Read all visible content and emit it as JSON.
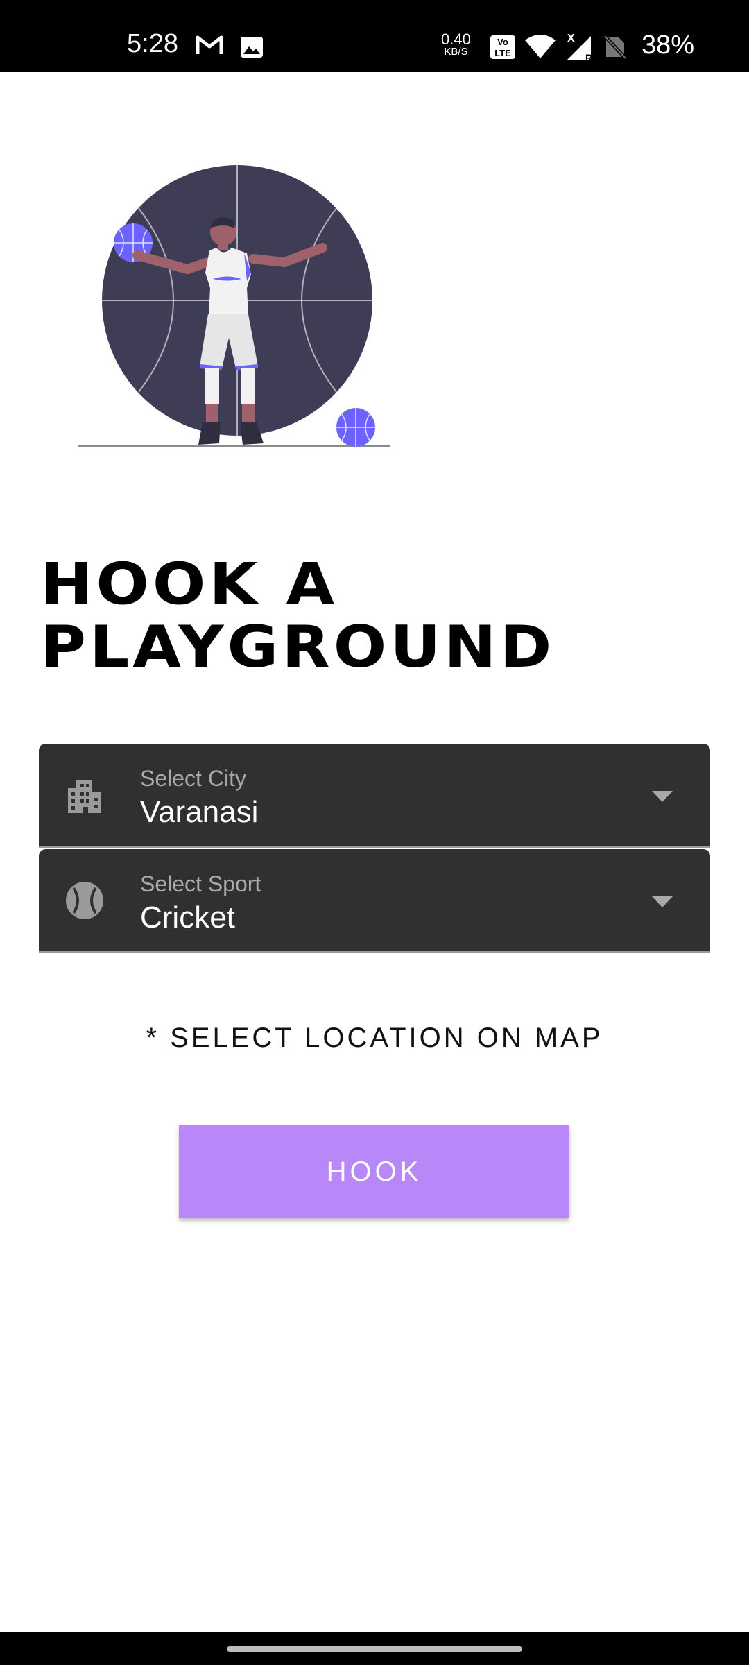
{
  "status_bar": {
    "time": "5:28",
    "net_speed": "0.40",
    "net_speed_unit": "KB/S",
    "battery": "38%",
    "icons": [
      "gmail-icon",
      "gallery-icon",
      "volte-icon",
      "wifi-icon",
      "signal-icon",
      "no-sim-icon"
    ]
  },
  "page": {
    "title_line1": "HOOK A",
    "title_line2": "PLAYGROUND"
  },
  "city_select": {
    "label": "Select City",
    "value": "Varanasi",
    "icon": "city-building-icon"
  },
  "sport_select": {
    "label": "Select Sport",
    "value": "Cricket",
    "icon": "ball-icon"
  },
  "location_note": "* SELECT LOCATION ON MAP",
  "hook_button": {
    "label": "HOOK"
  },
  "colors": {
    "accent": "#b888f8",
    "field_bg": "#303030",
    "illustration_dark": "#3f3d56",
    "illustration_accent": "#6c63ff"
  }
}
